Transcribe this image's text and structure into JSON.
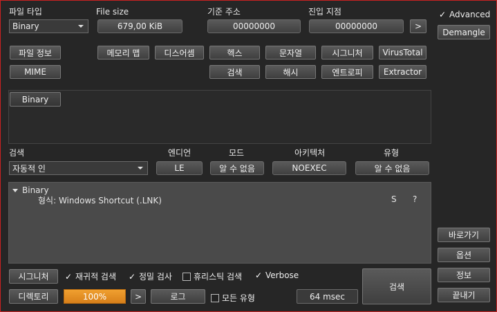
{
  "top": {
    "file_type_label": "파일 타입",
    "file_type_value": "Binary",
    "file_size_label": "File size",
    "file_size_value": "679,00 KiB",
    "base_address_label": "기준 주소",
    "base_address_value": "00000000",
    "entry_point_label": "진입 지점",
    "entry_point_value": "00000000",
    "go_button": ">"
  },
  "side": {
    "advanced_label": "Advanced",
    "demangle": "Demangle",
    "shortcuts": "바로가기",
    "options": "옵션",
    "about": "정보",
    "exit": "끝내기"
  },
  "tools": {
    "file_info": "파일 정보",
    "mime": "MIME",
    "memory_map": "메모리 맵",
    "disasm": "디스어셈",
    "hex": "헥스",
    "strings": "문자열",
    "signature": "시그니처",
    "virustotal": "VirusTotal",
    "search": "검색",
    "hash": "해시",
    "entropy": "엔트로피",
    "extractor": "Extractor"
  },
  "binary_tab": "Binary",
  "scan": {
    "search_label": "검색",
    "search_value": "자동적 인",
    "endian_label": "엔디언",
    "endian_value": "LE",
    "mode_label": "모드",
    "mode_value": "알 수 없음",
    "arch_label": "아키텍처",
    "arch_value": "NOEXEC",
    "type_label": "유형",
    "type_value": "알 수 없음"
  },
  "result": {
    "root": "Binary",
    "child": "형식: Windows Shortcut (.LNK)",
    "col_s": "S",
    "col_q": "?"
  },
  "bottom": {
    "signatures": "시그니처",
    "recursive": "재귀적 검색",
    "deep": "정밀 검사",
    "heuristic": "휴리스틱 검색",
    "verbose": "Verbose",
    "directory": "디렉토리",
    "progress": "100%",
    "arrow": ">",
    "log": "로그",
    "all_types": "모든 유형",
    "time": "64 msec",
    "scan": "검색"
  }
}
